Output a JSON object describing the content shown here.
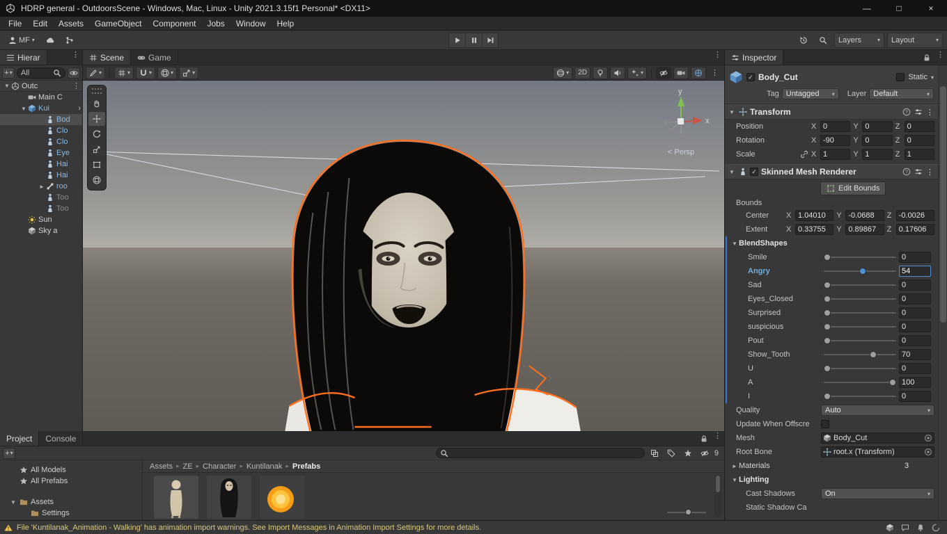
{
  "colors": {
    "accent": "#4f90d0",
    "selection_gray": "#4d4d4d",
    "prefab_text": "#8cb8de",
    "warning_text": "#d9c97e",
    "selection_outline": "#ff6f1e",
    "override_blue": "#2b7cd3"
  },
  "icons": {
    "chevron_down": "▾",
    "chevron_right": "›",
    "fold_open": "▼",
    "fold_closed": "►",
    "menu": "⋮",
    "plus": "+",
    "minimize": "—",
    "maximize": "□",
    "close": "×",
    "check": "✓",
    "crumb_sep": "▸",
    "help": "?"
  },
  "window": {
    "title": "HDRP general - OutdoorsScene - Windows, Mac, Linux - Unity 2021.3.15f1 Personal* <DX11>"
  },
  "menu": {
    "items": [
      "File",
      "Edit",
      "Assets",
      "GameObject",
      "Component",
      "Jobs",
      "Window",
      "Help"
    ]
  },
  "toolbar": {
    "account_label": "MF",
    "layers_label": "Layers",
    "layout_label": "Layout"
  },
  "hierarchy": {
    "tab": "Hierar",
    "filter": "All",
    "items": [
      {
        "label": "Outc",
        "depth": 0,
        "icon": "scene-icon",
        "arrow": "open",
        "trailing": "menu",
        "header": true
      },
      {
        "label": "Main C",
        "depth": 1,
        "icon": "camera-icon"
      },
      {
        "label": "Kui",
        "depth": 1,
        "icon": "prefab-icon",
        "arrow": "open",
        "blue": true,
        "trailing": "chevron"
      },
      {
        "label": "Bod",
        "depth": 2,
        "icon": "skinned-mesh-icon",
        "blue": true,
        "selected": true
      },
      {
        "label": "Clo",
        "depth": 2,
        "icon": "skinned-mesh-icon",
        "blue": true
      },
      {
        "label": "Clo",
        "depth": 2,
        "icon": "skinned-mesh-icon",
        "blue": true
      },
      {
        "label": "Eye",
        "depth": 2,
        "icon": "skinned-mesh-icon",
        "blue": true
      },
      {
        "label": "Hai",
        "depth": 2,
        "icon": "skinned-mesh-icon",
        "blue": true
      },
      {
        "label": "Hai",
        "depth": 2,
        "icon": "skinned-mesh-icon",
        "blue": true
      },
      {
        "label": "roo",
        "depth": 2,
        "icon": "bone-icon",
        "arrow": "closed",
        "blue": true
      },
      {
        "label": "Too",
        "depth": 2,
        "icon": "skinned-mesh-icon",
        "dim": true
      },
      {
        "label": "Too",
        "depth": 2,
        "icon": "skinned-mesh-icon",
        "dim": true
      },
      {
        "label": "Sun",
        "depth": 1,
        "icon": "light-icon"
      },
      {
        "label": "Sky a",
        "depth": 1,
        "icon": "cube-icon"
      }
    ]
  },
  "scene": {
    "tabs": [
      {
        "label": "Scene"
      },
      {
        "label": "Game"
      }
    ],
    "mode_2d": "2D",
    "persp": "< Persp",
    "axis_x": "x",
    "axis_y": "y"
  },
  "inspector": {
    "tab": "Inspector",
    "header": {
      "name": "Body_Cut",
      "static_label": "Static",
      "tag_label": "Tag",
      "tag": "Untagged",
      "layer_label": "Layer",
      "layer": "Default"
    },
    "transform": {
      "title": "Transform",
      "rows": [
        {
          "label": "Position",
          "x": "0",
          "y": "0",
          "z": "0"
        },
        {
          "label": "Rotation",
          "x": "-90",
          "y": "0",
          "z": "0"
        },
        {
          "label": "Scale",
          "x": "1",
          "y": "1",
          "z": "1",
          "linked": true
        }
      ]
    },
    "smr": {
      "title": "Skinned Mesh Renderer",
      "edit_bounds": "Edit Bounds",
      "bounds_label": "Bounds",
      "bounds_rows": [
        {
          "label": "Center",
          "x": "1.04010",
          "y": "-0.0688",
          "z": "-0.0026"
        },
        {
          "label": "Extent",
          "x": "0.33755",
          "y": "0.89867",
          "z": "0.17606"
        }
      ],
      "blendshapes_title": "BlendShapes",
      "blendshapes": [
        {
          "name": "Smile",
          "value": "0",
          "pct": 0
        },
        {
          "name": "Angry",
          "value": "54",
          "pct": 54,
          "active": true
        },
        {
          "name": "Sad",
          "value": "0",
          "pct": 0
        },
        {
          "name": "Eyes_Closed",
          "value": "0",
          "pct": 0
        },
        {
          "name": "Surprised",
          "value": "0",
          "pct": 0
        },
        {
          "name": "suspicious",
          "value": "0",
          "pct": 0
        },
        {
          "name": "Pout",
          "value": "0",
          "pct": 0
        },
        {
          "name": "Show_Tooth",
          "value": "70",
          "pct": 70
        },
        {
          "name": "U",
          "value": "0",
          "pct": 0
        },
        {
          "name": "A",
          "value": "100",
          "pct": 100
        },
        {
          "name": "I",
          "value": "0",
          "pct": 0
        }
      ],
      "quality_label": "Quality",
      "quality": "Auto",
      "update_label": "Update When Offscre",
      "mesh_label": "Mesh",
      "mesh": "Body_Cut",
      "root_label": "Root Bone",
      "root": "root.x (Transform)",
      "materials_label": "Materials",
      "materials": "3",
      "lighting_title": "Lighting",
      "cast_label": "Cast Shadows",
      "cast": "On",
      "static_shadow_label": "Static Shadow Ca"
    }
  },
  "project": {
    "tabs": [
      {
        "label": "Project"
      },
      {
        "label": "Console"
      }
    ],
    "favorites": [
      {
        "label": "All Models"
      },
      {
        "label": "All Prefabs"
      }
    ],
    "folders": [
      {
        "label": "Assets",
        "depth": 0,
        "arrow": "open"
      },
      {
        "label": "Settings",
        "depth": 1
      }
    ],
    "breadcrumb": [
      "Assets",
      "ZE",
      "Character",
      "Kuntilanak",
      "Prefabs"
    ],
    "hidden_count": "9"
  },
  "status": {
    "message": "File 'Kuntilanak_Animation - Walking' has animation import warnings. See Import Messages in Animation Import Settings for more details."
  }
}
